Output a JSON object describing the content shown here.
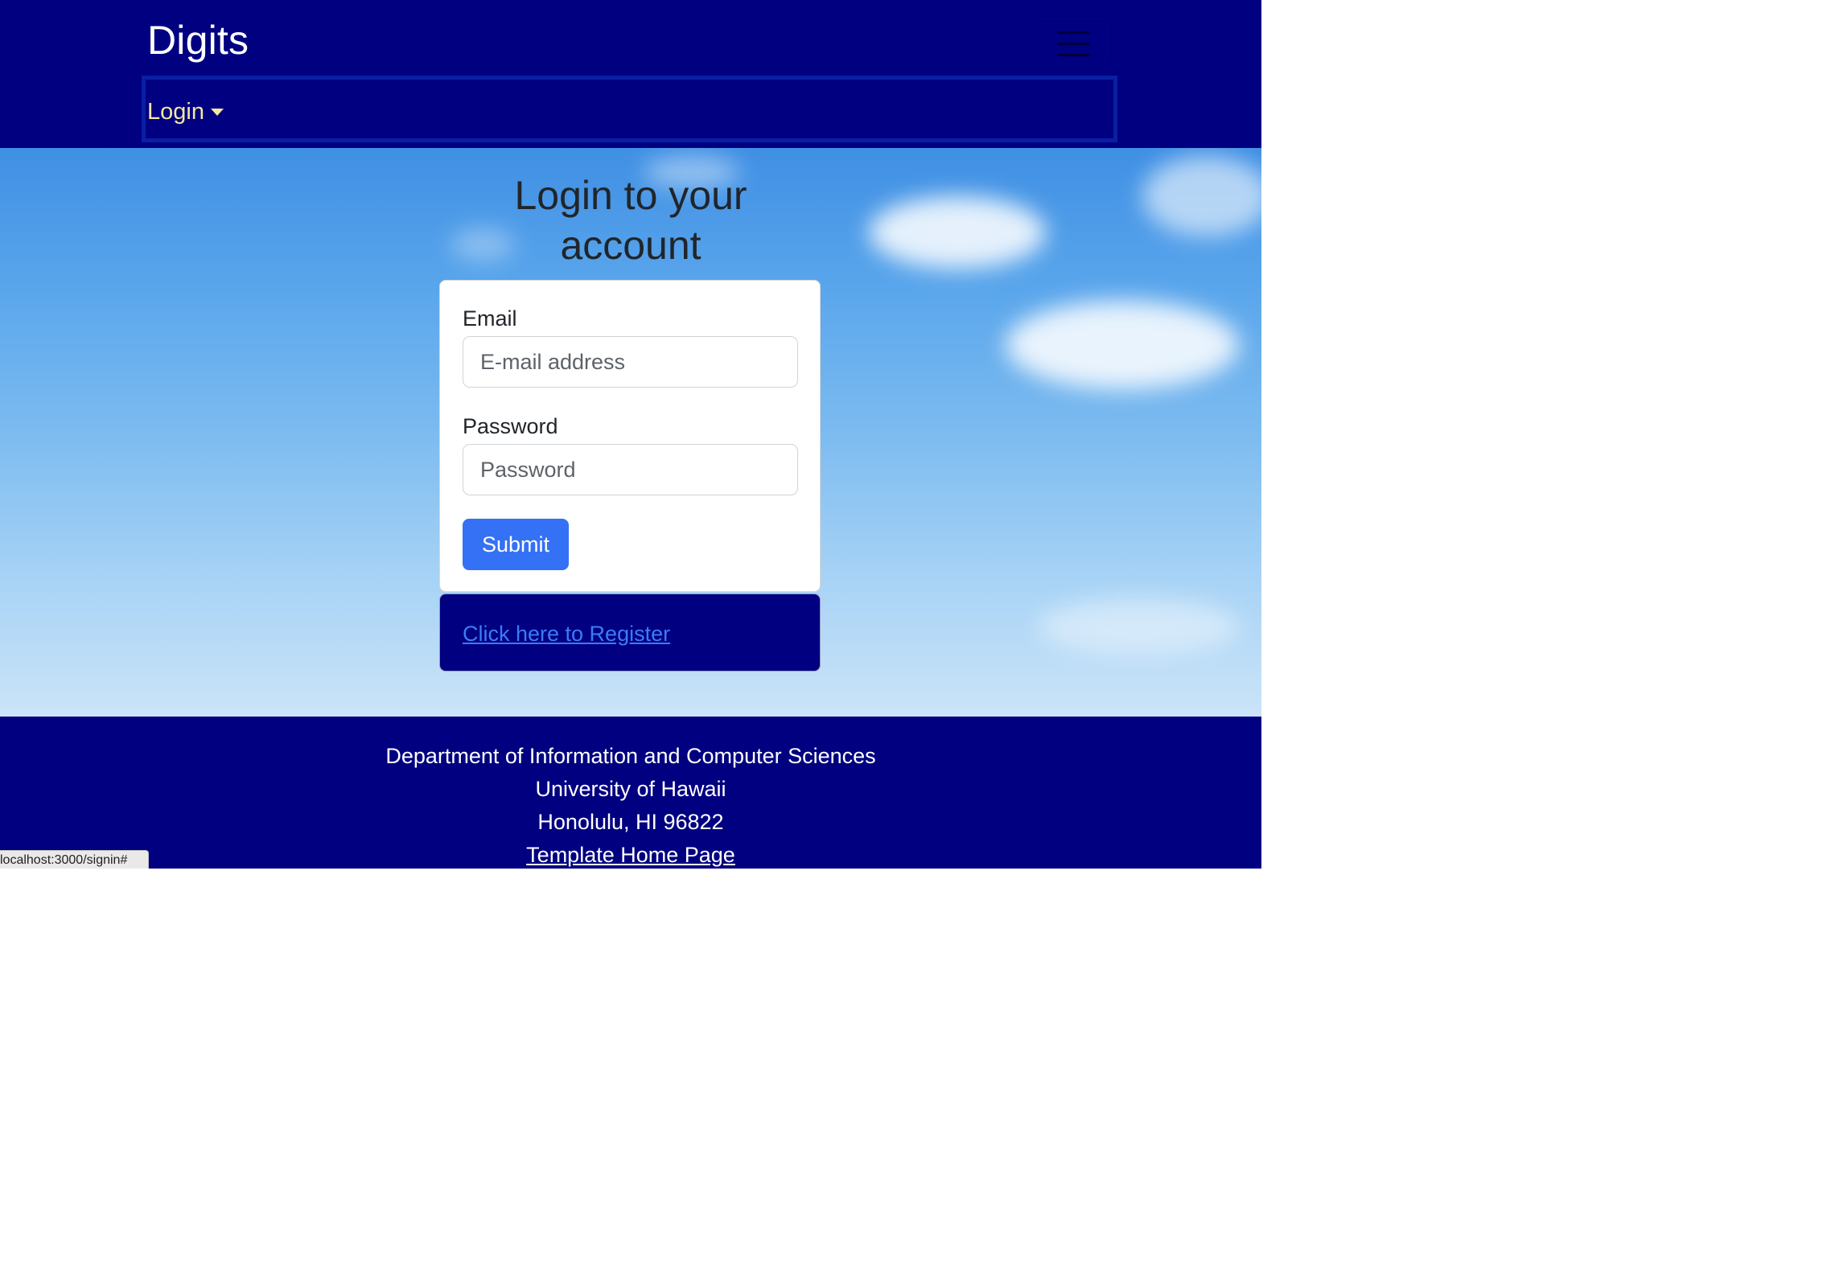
{
  "navbar": {
    "brand": "Digits",
    "menu": {
      "login_label": "Login"
    }
  },
  "main": {
    "heading_line1": "Login to your",
    "heading_line2": "account",
    "form": {
      "email_label": "Email",
      "email_placeholder": "E-mail address",
      "email_value": "",
      "password_label": "Password",
      "password_placeholder": "Password",
      "password_value": "",
      "submit_label": "Submit"
    },
    "register_link": "Click here to Register"
  },
  "footer": {
    "line1": "Department of Information and Computer Sciences",
    "line2": "University of Hawaii",
    "line3": "Honolulu, HI 96822",
    "link": "Template Home Page"
  },
  "status_bar": {
    "url": "localhost:3000/signin#"
  },
  "colors": {
    "navbar_bg": "#000080",
    "nav_link": "#f6e7a1",
    "submit_bg": "#3471f5",
    "register_link": "#3d7bf7"
  }
}
